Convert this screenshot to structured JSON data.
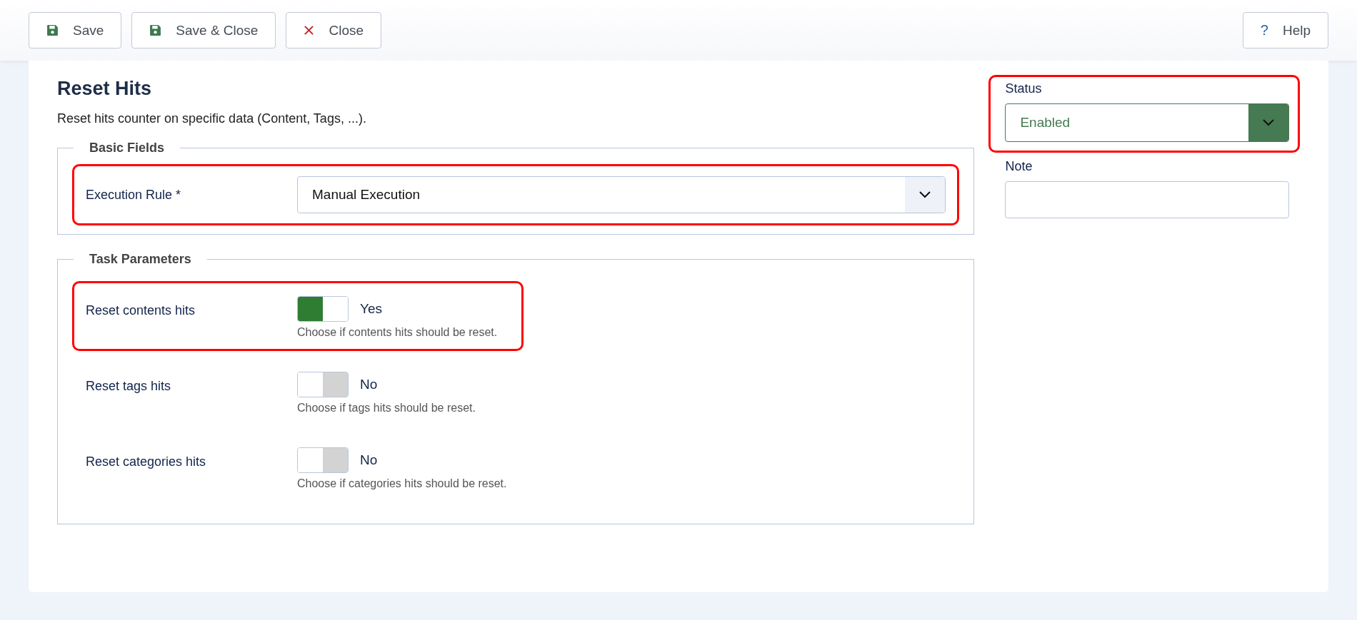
{
  "toolbar": {
    "buttons": [
      {
        "label": "Save",
        "kind": "save"
      },
      {
        "label": "Save & Close",
        "kind": "save"
      },
      {
        "label": "Close",
        "kind": "close"
      }
    ],
    "help": {
      "label": "Help",
      "icon": "?"
    }
  },
  "page": {
    "title": "Reset Hits",
    "description": "Reset hits counter on specific data (Content, Tags, ...)."
  },
  "basic_fields": {
    "legend": "Basic Fields",
    "execution_rule": {
      "label": "Execution Rule *",
      "value": "Manual Execution",
      "highlighted": true
    }
  },
  "task_parameters": {
    "legend": "Task Parameters",
    "rows": [
      {
        "label": "Reset contents hits",
        "on": true,
        "state_label": "Yes",
        "hint": "Choose if contents hits should be reset.",
        "highlighted": true
      },
      {
        "label": "Reset tags hits",
        "on": false,
        "state_label": "No",
        "hint": "Choose if tags hits should be reset.",
        "highlighted": false
      },
      {
        "label": "Reset categories hits",
        "on": false,
        "state_label": "No",
        "hint": "Choose if categories hits should be reset.",
        "highlighted": false
      }
    ]
  },
  "status": {
    "label": "Status",
    "value": "Enabled",
    "highlighted": true
  },
  "note": {
    "label": "Note"
  }
}
